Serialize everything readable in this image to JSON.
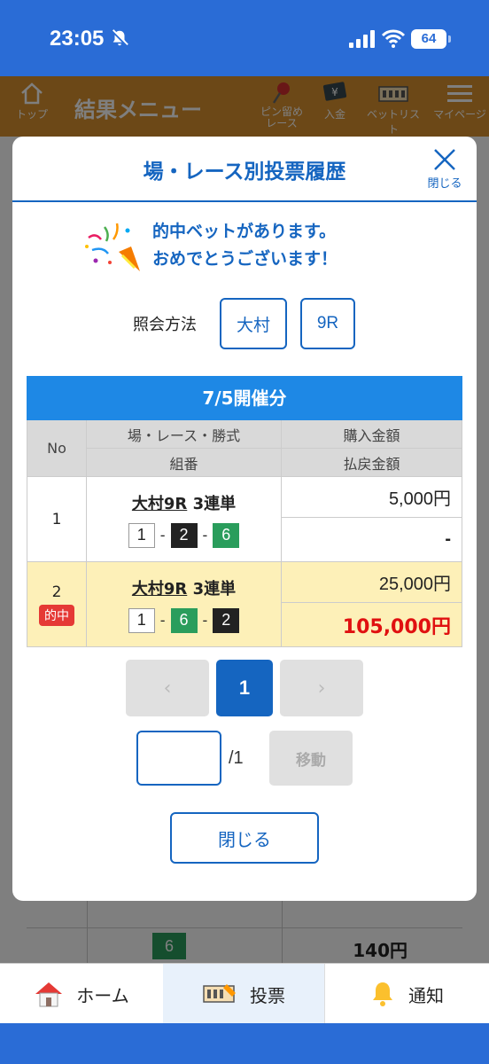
{
  "status": {
    "time": "23:05",
    "battery": "64"
  },
  "app_header": {
    "title": "結果メニュー",
    "top_label": "トップ",
    "pin_label_1": "ピン留め",
    "pin_label_2": "レース",
    "deposit_label": "入金",
    "betlist_label": "ベットリスト",
    "mypage_label": "マイページ"
  },
  "background": {
    "badge": "6",
    "amount": "140円"
  },
  "modal": {
    "title": "場・レース別投票履歴",
    "close_label": "閉じる",
    "congrats_line1": "的中ベットがあります。",
    "congrats_line2": "おめでとうございます！",
    "query_label": "照会方法",
    "venue_button": "大村",
    "race_button": "9R",
    "table": {
      "date_header": "7/5開催分",
      "col_no": "No",
      "col_race": "場・レース・勝式",
      "col_combo": "組番",
      "col_purchase": "購入金額",
      "col_payout": "払戻金額",
      "rows": [
        {
          "no": "1",
          "venue_race": "大村9R",
          "bet_type": "3連単",
          "combo": [
            "1",
            "2",
            "6"
          ],
          "purchase": "5,000円",
          "payout": "-",
          "hit": false
        },
        {
          "no": "2",
          "hit_label": "的中",
          "venue_race": "大村9R",
          "bet_type": "3連単",
          "combo": [
            "1",
            "6",
            "2"
          ],
          "purchase": "25,000円",
          "payout": "105,000円",
          "hit": true
        }
      ]
    },
    "pager": {
      "prev": "‹",
      "current": "1",
      "next": "›"
    },
    "page_jump": {
      "value": "",
      "total": "/1",
      "move_label": "移動"
    },
    "close_button": "閉じる"
  },
  "bottom_nav": {
    "home": "ホーム",
    "vote": "投票",
    "notify": "通知"
  },
  "colors": {
    "primary": "#1565c0",
    "header": "#d9912e",
    "hit_row": "#fdf0b8",
    "payout_red": "#e01010"
  }
}
